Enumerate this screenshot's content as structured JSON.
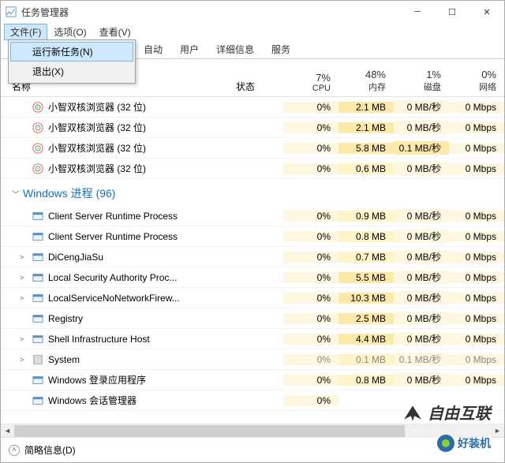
{
  "window": {
    "title": "任务管理器"
  },
  "menu": {
    "file": "文件(F)",
    "options": "选项(O)",
    "view": "查看(V)",
    "dropdown": {
      "new_task": "运行新任务(N)",
      "exit": "退出(X)"
    }
  },
  "tabs": {
    "auto": "自动",
    "users": "用户",
    "details": "详细信息",
    "services": "服务"
  },
  "columns": {
    "name": "名称",
    "status": "状态",
    "cpu_pct": "7%",
    "cpu": "CPU",
    "mem_pct": "48%",
    "mem": "内存",
    "disk_pct": "1%",
    "disk": "磁盘",
    "net_pct": "0%",
    "net": "网络"
  },
  "group": {
    "label": "Windows 进程 (96)"
  },
  "rows": [
    {
      "icon": "browser",
      "name": "小智双核浏览器 (32 位)",
      "cpu": "0%",
      "mem": "2.1 MB",
      "disk": "0 MB/秒",
      "net": "0 Mbps",
      "memH": true
    },
    {
      "icon": "browser",
      "name": "小智双核浏览器 (32 位)",
      "cpu": "0%",
      "mem": "2.1 MB",
      "disk": "0 MB/秒",
      "net": "0 Mbps",
      "memH": true
    },
    {
      "icon": "browser",
      "name": "小智双核浏览器 (32 位)",
      "cpu": "0%",
      "mem": "5.8 MB",
      "disk": "0.1 MB/秒",
      "net": "0 Mbps",
      "memH": true,
      "diskH": true
    },
    {
      "icon": "browser",
      "name": "小智双核浏览器 (32 位)",
      "cpu": "0%",
      "mem": "0.6 MB",
      "disk": "0 MB/秒",
      "net": "0 Mbps"
    }
  ],
  "rows2": [
    {
      "icon": "svc",
      "name": "Client Server Runtime Process",
      "cpu": "0%",
      "mem": "0.9 MB",
      "disk": "0 MB/秒",
      "net": "0 Mbps"
    },
    {
      "icon": "svc",
      "name": "Client Server Runtime Process",
      "cpu": "0%",
      "mem": "0.8 MB",
      "disk": "0 MB/秒",
      "net": "0 Mbps"
    },
    {
      "icon": "svc",
      "name": "DiCengJiaSu",
      "cpu": "0%",
      "mem": "0.7 MB",
      "disk": "0 MB/秒",
      "net": "0 Mbps",
      "exp": true
    },
    {
      "icon": "svc",
      "name": "Local Security Authority Proc...",
      "cpu": "0%",
      "mem": "5.5 MB",
      "disk": "0 MB/秒",
      "net": "0 Mbps",
      "exp": true,
      "memH": true
    },
    {
      "icon": "svc",
      "name": "LocalServiceNoNetworkFirew...",
      "cpu": "0%",
      "mem": "10.3 MB",
      "disk": "0 MB/秒",
      "net": "0 Mbps",
      "exp": true,
      "memH": true
    },
    {
      "icon": "svc",
      "name": "Registry",
      "cpu": "0%",
      "mem": "2.5 MB",
      "disk": "0 MB/秒",
      "net": "0 Mbps",
      "memH": true
    },
    {
      "icon": "svc",
      "name": "Shell Infrastructure Host",
      "cpu": "0%",
      "mem": "4.4 MB",
      "disk": "0 MB/秒",
      "net": "0 Mbps",
      "exp": true,
      "memH": true
    },
    {
      "icon": "sys",
      "name": "System",
      "cpu": "0%",
      "mem": "0.1 MB",
      "disk": "0.1 MB/秒",
      "net": "0 Mbps",
      "exp": true,
      "dim": true
    },
    {
      "icon": "svc",
      "name": "Windows 登录应用程序",
      "cpu": "0%",
      "mem": "0.8 MB",
      "disk": "0 MB/秒",
      "net": "0 Mbps"
    },
    {
      "icon": "svc",
      "name": "Windows 会话管理器",
      "cpu": "0%",
      "mem": "",
      "disk": "",
      "net": "",
      "cut": true
    }
  ],
  "bottom": {
    "brief": "简略信息(D)"
  },
  "watermark": {
    "text": "自由互联",
    "text2": "好装机"
  }
}
